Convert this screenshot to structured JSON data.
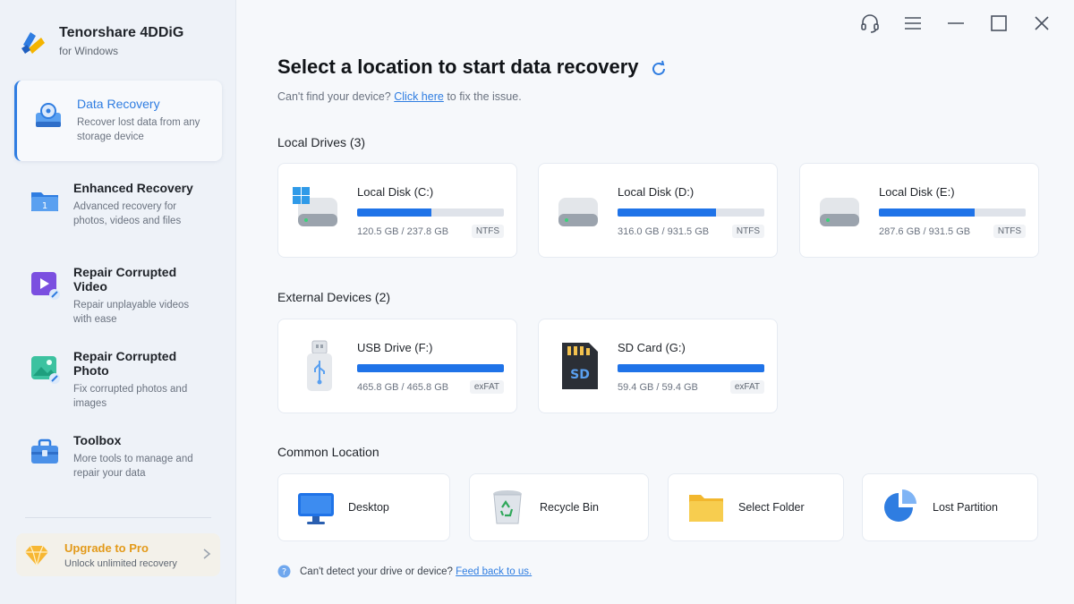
{
  "app": {
    "name": "Tenorshare 4DDiG",
    "subtitle": "for Windows"
  },
  "sidebar": {
    "items": [
      {
        "title": "Data Recovery",
        "desc": "Recover lost data from any storage device",
        "icon": "data-recovery-icon",
        "active": true
      },
      {
        "title": "Enhanced Recovery",
        "desc": "Advanced recovery for photos, videos and files",
        "icon": "enhanced-recovery-icon"
      },
      {
        "title": "Repair Corrupted Video",
        "desc": "Repair unplayable videos with ease",
        "icon": "repair-video-icon"
      },
      {
        "title": "Repair Corrupted Photo",
        "desc": "Fix corrupted photos and images",
        "icon": "repair-photo-icon"
      },
      {
        "title": "Toolbox",
        "desc": "More tools to manage and repair your data",
        "icon": "toolbox-icon"
      }
    ],
    "upgrade": {
      "title": "Upgrade to Pro",
      "subtitle": "Unlock unlimited recovery"
    }
  },
  "main": {
    "title": "Select a location to start data recovery",
    "hint": {
      "before": "Can't find your device?",
      "link": "Click here",
      "after": "to fix the issue."
    },
    "local_title": "Local Drives (3)",
    "local_drives": [
      {
        "name": "Local Disk (C:)",
        "size": "120.5 GB / 237.8 GB",
        "fs": "NTFS",
        "used_fraction": 0.507,
        "system": true
      },
      {
        "name": "Local Disk (D:)",
        "size": "316.0 GB / 931.5 GB",
        "fs": "NTFS",
        "used_fraction": 0.67
      },
      {
        "name": "Local Disk (E:)",
        "size": "287.6 GB / 931.5 GB",
        "fs": "NTFS",
        "used_fraction": 0.65
      }
    ],
    "external_title": "External Devices (2)",
    "external_devices": [
      {
        "name": "USB Drive (F:)",
        "size": "465.8 GB / 465.8 GB",
        "fs": "exFAT",
        "used_fraction": 1.0
      },
      {
        "name": "SD Card (G:)",
        "size": "59.4 GB / 59.4 GB",
        "fs": "exFAT",
        "used_fraction": 1.0
      }
    ],
    "common_title": "Common Location",
    "common_locations": [
      {
        "label": "Desktop",
        "icon": "desktop-icon"
      },
      {
        "label": "Recycle Bin",
        "icon": "recycle-bin-icon"
      },
      {
        "label": "Select Folder",
        "icon": "folder-icon"
      },
      {
        "label": "Lost Partition",
        "icon": "lost-partition-icon"
      }
    ],
    "footer": {
      "text": "Can't detect your drive or device?",
      "link": "Feed back to us."
    }
  },
  "colors": {
    "accent": "#2f7de1",
    "bar": "#1f73e8",
    "upgrade": "#e39a1a"
  }
}
